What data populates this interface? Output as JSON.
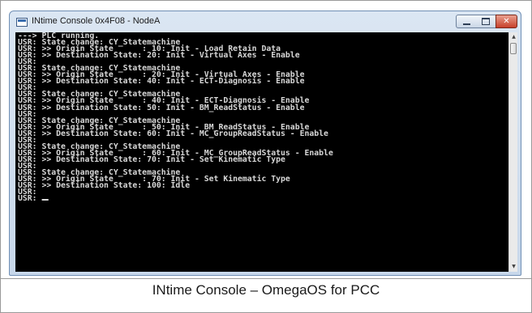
{
  "window": {
    "title": "INtime Console 0x4F08 - NodeA",
    "minimize_icon": "minimize-icon",
    "maximize_icon": "maximize-icon",
    "close_icon": "close-icon"
  },
  "console": {
    "lines": [
      "---> PLC running.",
      "USR: State change: CY_Statemachine",
      "USR: >> Origin State      : 10: Init - Load Retain Data",
      "USR: >> Destination State: 20: Init - Virtual Axes - Enable",
      "USR:",
      "USR: State change: CY_Statemachine",
      "USR: >> Origin State      : 20: Init - Virtual Axes - Enable",
      "USR: >> Destination State: 40: Init - ECT-Diagnosis - Enable",
      "USR:",
      "USR: State change: CY_Statemachine",
      "USR: >> Origin State      : 40: Init - ECT-Diagnosis - Enable",
      "USR: >> Destination State: 50: Init - BM_ReadStatus - Enable",
      "USR:",
      "USR: State change: CY_Statemachine",
      "USR: >> Origin State      : 50: Init - BM_ReadStatus - Enable",
      "USR: >> Destination State: 60: Init - MC_GroupReadStatus - Enable",
      "USR:",
      "USR: State change: CY_Statemachine",
      "USR: >> Origin State      : 60: Init - MC_GroupReadStatus - Enable",
      "USR: >> Destination State: 70: Init - Set Kinematic Type",
      "USR:",
      "USR: State change: CY_Statemachine",
      "USR: >> Origin State      : 70: Init - Set Kinematic Type",
      "USR: >> Destination State: 100: Idle",
      "USR:",
      "USR: "
    ]
  },
  "scrollbar": {
    "up_icon": "▲",
    "down_icon": "▼"
  },
  "caption": "INtime Console – OmegaOS for PCC"
}
